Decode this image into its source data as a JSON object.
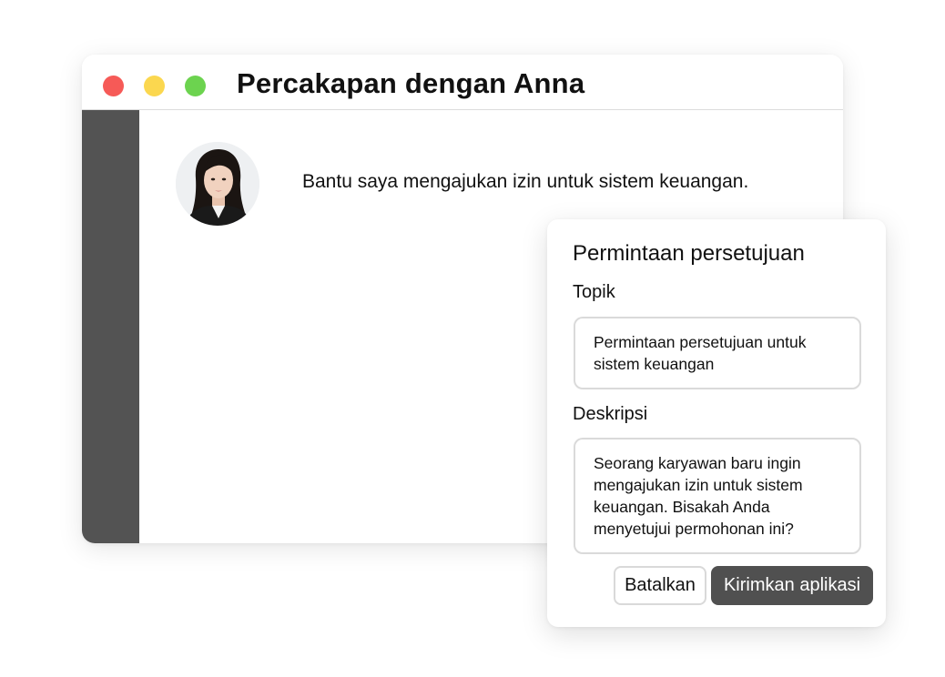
{
  "window": {
    "title": "Percakapan dengan Anna",
    "controls": [
      "close",
      "minimize",
      "maximize"
    ]
  },
  "conversation": {
    "contact_avatar": "avatar-anna",
    "message": "Bantu saya mengajukan izin untuk sistem keuangan."
  },
  "dialog": {
    "title": "Permintaan persetujuan",
    "topic_label": "Topik",
    "topic_value": "Permintaan persetujuan untuk sistem keuangan",
    "description_label": "Deskripsi",
    "description_value": "Seorang karyawan baru ingin mengajukan izin untuk sistem keuangan. Bisakah Anda menyetujui permohonan ini?",
    "cancel_label": "Batalkan",
    "submit_label": "Kirimkan aplikasi"
  },
  "colors": {
    "close": "#f65a57",
    "minimize": "#fbd74f",
    "maximize": "#6cd34f",
    "sidebar": "#535353",
    "submit_button": "#505050"
  }
}
